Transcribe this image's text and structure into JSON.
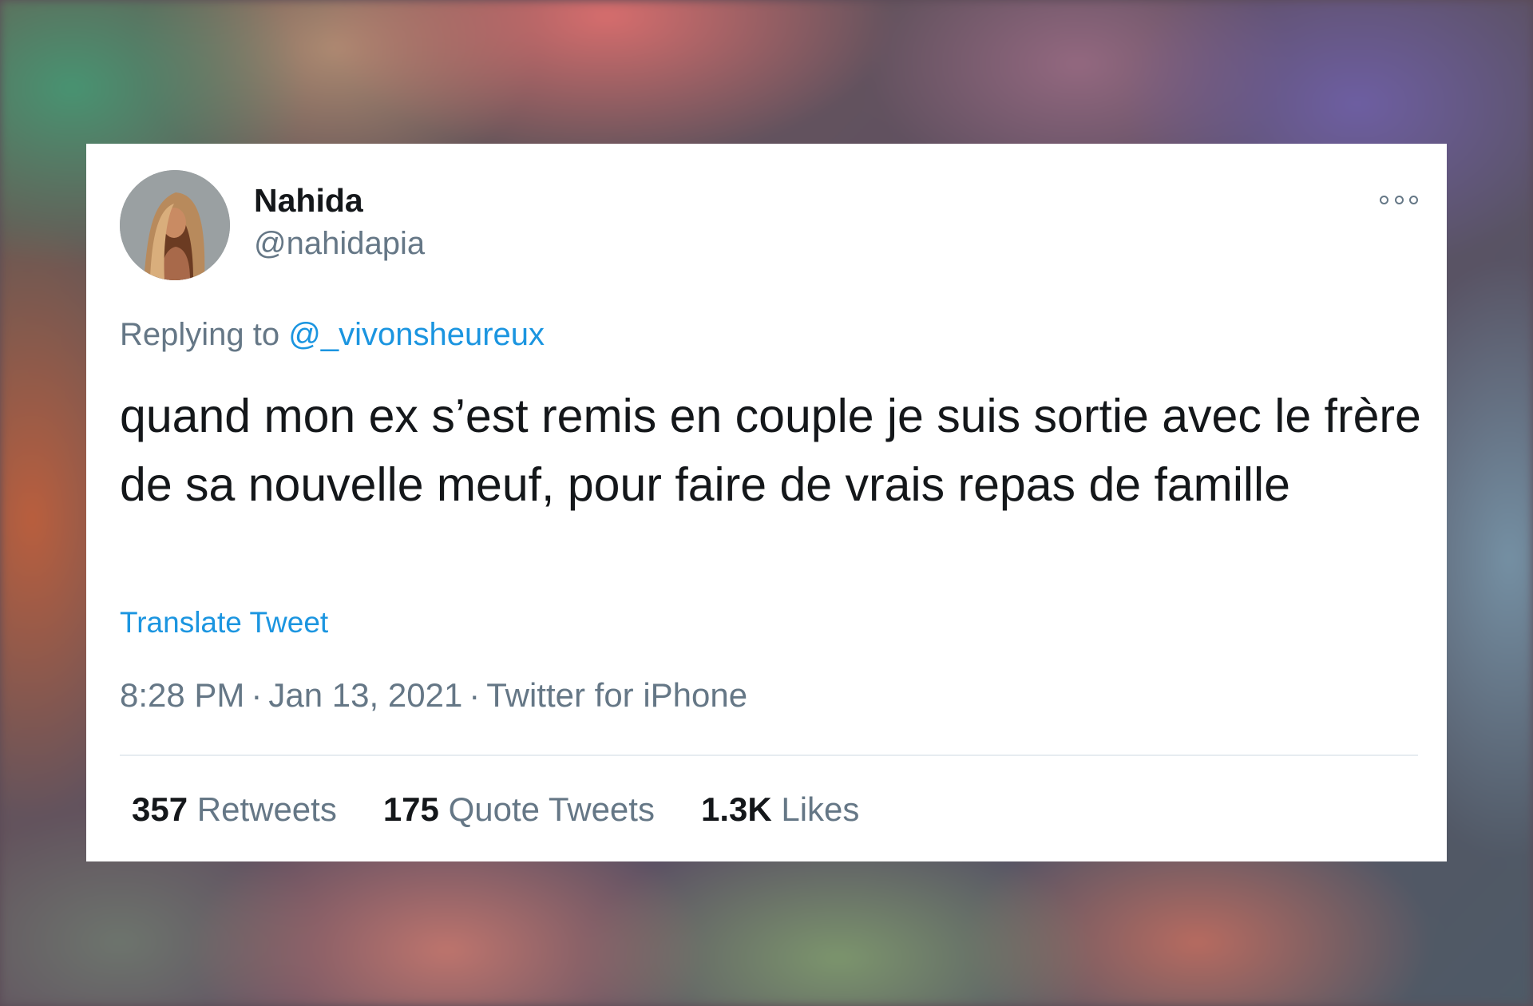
{
  "tweet": {
    "author": {
      "name": "Nahida",
      "handle": "@nahidapia"
    },
    "reply": {
      "prefix": "Replying to",
      "mention": "@_vivonsheureux"
    },
    "text": "quand mon ex s’est remis en couple je suis sortie avec le frère de sa nouvelle meuf, pour faire de vrais repas de famille",
    "translate_label": "Translate Tweet",
    "meta": {
      "time": "8:28 PM",
      "date": "Jan 13, 2021",
      "source": "Twitter for iPhone",
      "separator": "·"
    },
    "stats": [
      {
        "count": "357",
        "label": "Retweets"
      },
      {
        "count": "175",
        "label": "Quote Tweets"
      },
      {
        "count": "1.3K",
        "label": "Likes"
      }
    ]
  },
  "icons": {
    "more": "more-options-icon"
  },
  "colors": {
    "text": "#14171a",
    "muted": "#657786",
    "link": "#1b95e0",
    "card": "#ffffff"
  }
}
